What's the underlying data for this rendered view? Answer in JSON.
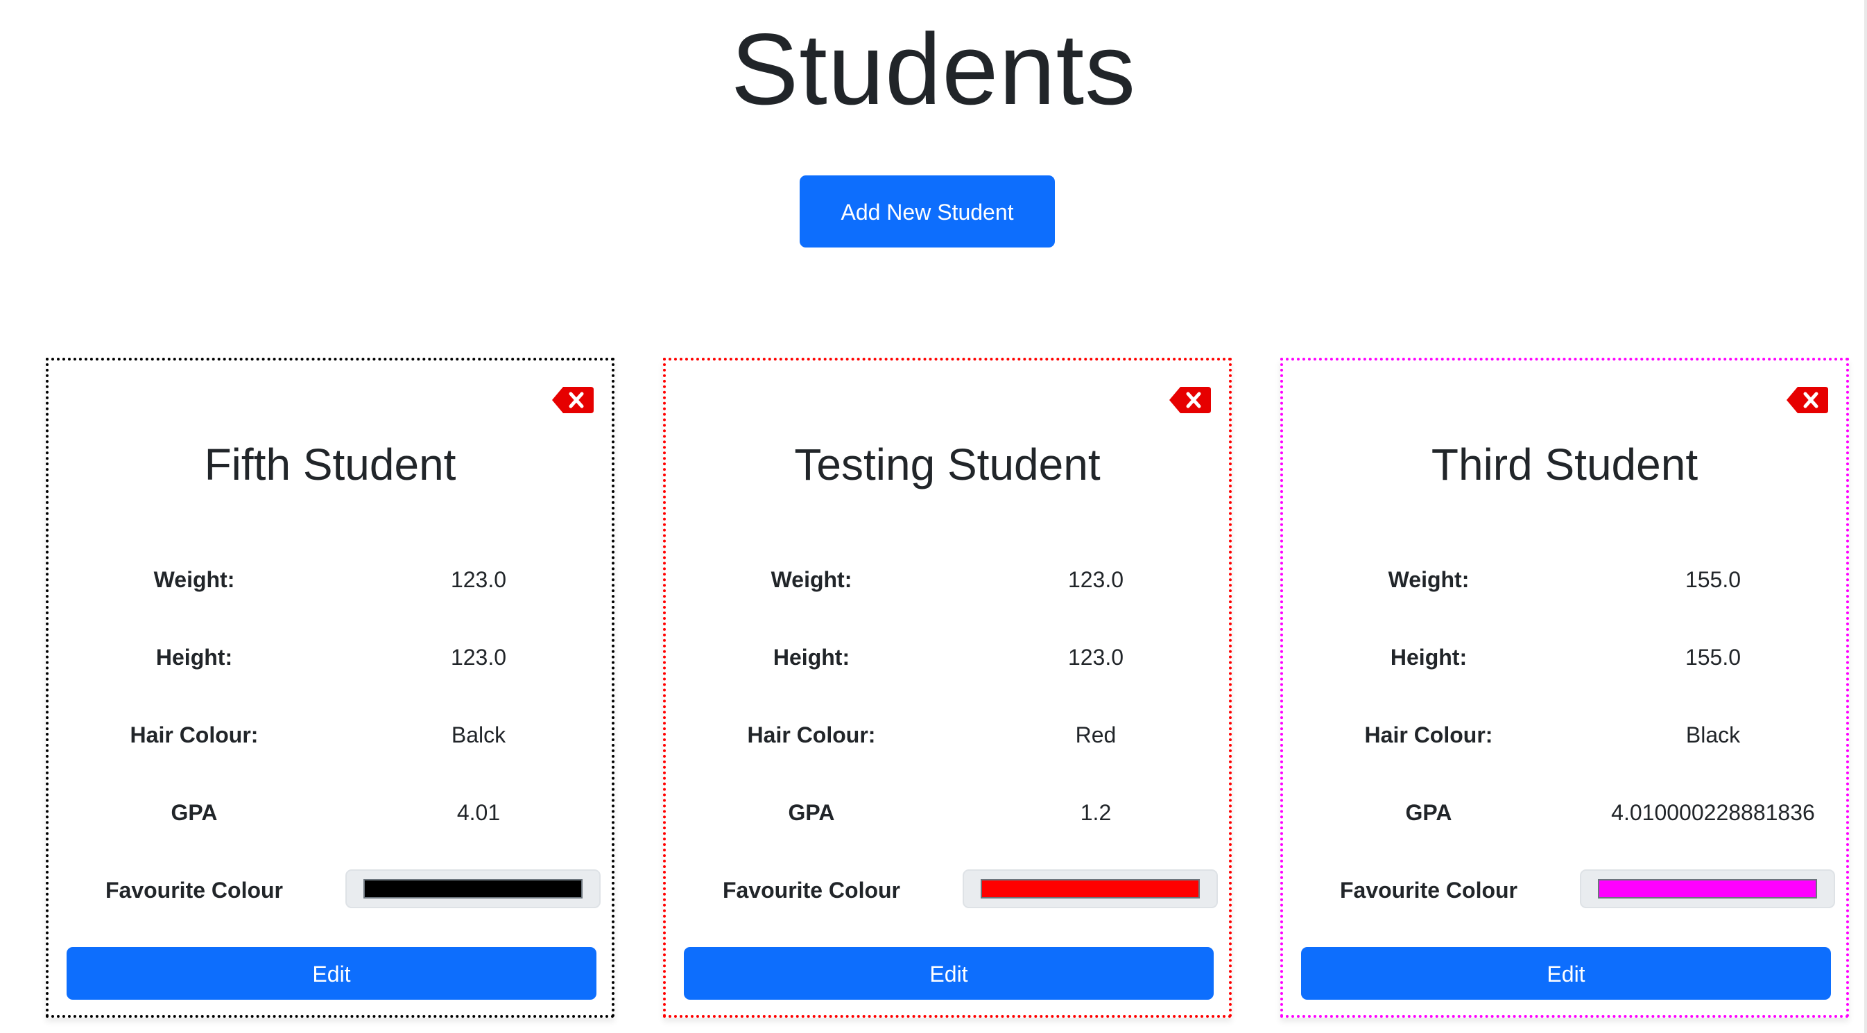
{
  "header": {
    "title": "Students",
    "add_button_label": "Add New Student"
  },
  "labels": {
    "weight": "Weight:",
    "height": "Height:",
    "hair_colour": "Hair Colour:",
    "gpa": "GPA",
    "favourite_colour": "Favourite Colour",
    "edit": "Edit"
  },
  "students": [
    {
      "name": "Fifth Student",
      "weight": "123.0",
      "height": "123.0",
      "hair_colour": "Balck",
      "gpa": "4.01",
      "favourite_colour": "#000000",
      "border_colour": "#000000"
    },
    {
      "name": "Testing Student",
      "weight": "123.0",
      "height": "123.0",
      "hair_colour": "Red",
      "gpa": "1.2",
      "favourite_colour": "#ff0000",
      "border_colour": "#ff0000"
    },
    {
      "name": "Third Student",
      "weight": "155.0",
      "height": "155.0",
      "hair_colour": "Black",
      "gpa": "4.010000228881836",
      "favourite_colour": "#ff00ff",
      "border_colour": "#ff00ff"
    }
  ],
  "icons": {
    "delete": "backspace-x-icon",
    "delete_color": "#e60000"
  },
  "colors": {
    "primary": "#0d6efd"
  }
}
